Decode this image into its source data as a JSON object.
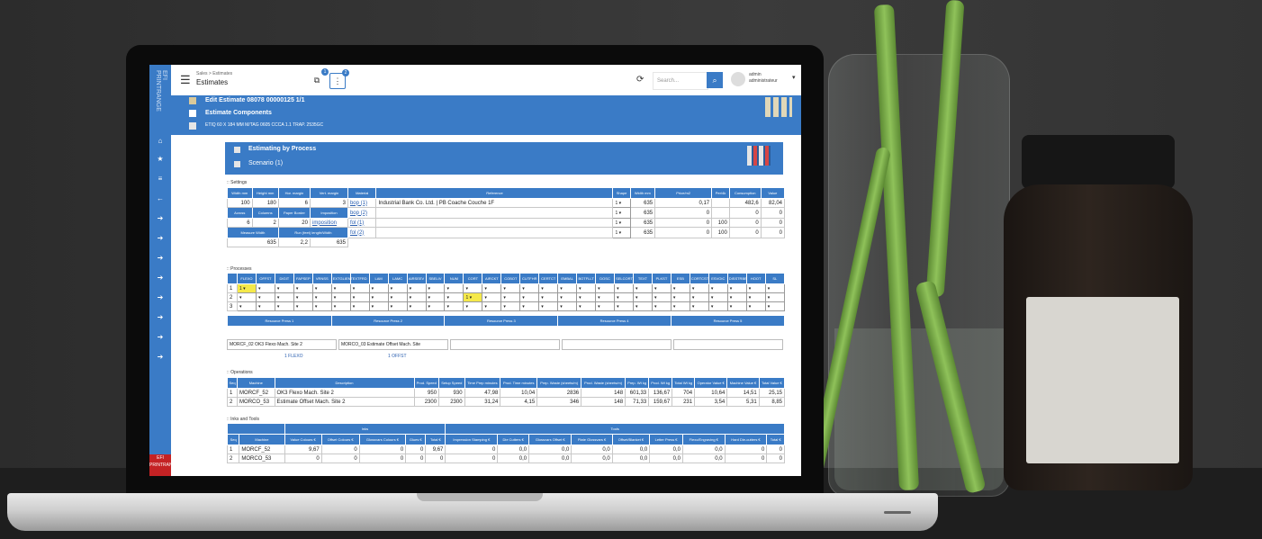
{
  "app": {
    "brand": "EFI PRINTRANGE",
    "footer": "EFI PRINTRANGE",
    "breadcrumb": "Sales > Estimates",
    "title": "Estimates",
    "badge1": "1",
    "badge2": "2",
    "search_placeholder": "Search...",
    "user_name": "admin",
    "user_company": "administrateur",
    "user_caret": "▾"
  },
  "header": {
    "line1": "Edit Estimate 08078 00000125 1/1",
    "line2": "Estimate Components",
    "line3": "ETIQ 60 X 184 MM M/TAG 0605 CCCA 1.1 TRAP. 2535GC"
  },
  "panel": {
    "title": "Estimating by Process",
    "subtitle": "Scenario (1)"
  },
  "settings": {
    "label": ":: Settings",
    "head": [
      "Width mm",
      "Height mm",
      "Hor. margin",
      "Vert. margin",
      "Material",
      "Reference",
      "Shape",
      "Width mm",
      "Price/m2",
      "Per/4k",
      "Consumption",
      "Value"
    ],
    "head2": [
      "Across",
      "Columns",
      "Paper Border",
      "Imposition"
    ],
    "head3": [
      "Measure Width",
      "Run (feet) length/Width"
    ],
    "row1": {
      "w": "100",
      "h": "180",
      "hm": "6",
      "vm": "3",
      "mat": "bop (1)",
      "ref": "Industrial Bank Co. Ltd. | PB Coache Couche 1F",
      "shape": "1 ▾",
      "width": "635",
      "price": "0,17",
      "per": "",
      "cons": "482,6",
      "val": "82,04"
    },
    "row2": {
      "a": "6",
      "c": "2",
      "pb": "20",
      "imp": "imposition",
      "mat": "bop (2)",
      "shape": "1 ▾",
      "width": "635",
      "price": "0",
      "per": "",
      "cons": "0",
      "val": "0"
    },
    "row3": {
      "mat": "fol (1)",
      "shape": "1 ▾",
      "width": "635",
      "price": "0",
      "per": "100",
      "cons": "0",
      "val": "0"
    },
    "row4": {
      "mw": "635",
      "rl": "2,2",
      "rw": "635",
      "mat": "fol (2)",
      "shape": "1 ▾",
      "width": "635",
      "price": "0",
      "per": "100",
      "cons": "0",
      "val": "0"
    }
  },
  "processes": {
    "label": ":: Processes",
    "cols": [
      "FLEXO",
      "OFFST",
      "DIGIT",
      "FAPSEP",
      "VRNSS",
      "EXTGLIENT",
      "EXTFRD",
      "LAM",
      "LAMC",
      "AIRSEEV",
      "SBELIV",
      "NUM",
      "CORT",
      "AIRCKT",
      "COBOT",
      "CUTFHR",
      "CERTCT",
      "EMBAL",
      "BOTFLLT",
      "DOSC",
      "SELCORT",
      "TEXT",
      "PLKST",
      "ESB",
      "CORTCST",
      "ESVOIC",
      "DISSTRBB",
      "HOOT",
      "SL"
    ],
    "rows": [
      "1",
      "2",
      "3"
    ],
    "sel_1_flexo": "1 ▾",
    "sel_2_cort": "1 ▾",
    "resource_heads": [
      "Resource Press 1",
      "Resource Press 2",
      "Resource Press 3",
      "Resource Press 4",
      "Resource Press 5"
    ],
    "resource1": "MORCF_02 OK3 Flexo Mach. Site 2",
    "resource2": "MORCO_03 Estimate Offset Mach. Site",
    "sub1": "1 FLEXO",
    "sub2": "1 OFFST"
  },
  "operations": {
    "label": ":: Operations",
    "head": [
      "Seq",
      "Machine",
      "Description",
      "Prod. Speed",
      "Setup Speed",
      "Time Prep minutes",
      "Prod. Time minutes",
      "Prep. Waste (sheets/m)",
      "Prod. Waste (sheets/m)",
      "Prep. Wt kg",
      "Prod. Wt kg",
      "Total Wt kg",
      "Operator Value €",
      "Machine Value €",
      "Total Value €"
    ],
    "rows": [
      [
        "1",
        "MORCF_52",
        "OK3 Flexo Mach. Site 2",
        "950",
        "930",
        "47,98",
        "10,04",
        "2836",
        "148",
        "601,33",
        "136,67",
        "704",
        "10,64",
        "14,51",
        "25,15"
      ],
      [
        "2",
        "MORCO_53",
        "Estimate Offset Mach. Site 2",
        "2300",
        "2300",
        "31,24",
        "4,15",
        "346",
        "148",
        "71,33",
        "159,67",
        "231",
        "3,54",
        "5,31",
        "8,85"
      ]
    ]
  },
  "inks": {
    "label": ":: Inks and Tools",
    "group1": "Inks",
    "group2": "Tools",
    "head": [
      "Seq",
      "Machine",
      "Value Colours €",
      "Offset Colours €",
      "Glossvars Colours €",
      "Glues €",
      "Total €",
      "Impression Stamping €",
      "Die Cutters €",
      "Glossvars Offset €",
      "Plate Glossvars €",
      "Offset/Blanket €",
      "Letter Press €",
      "Flexo/Engraving €",
      "Hard Die-cutters €",
      "Total €"
    ],
    "rows": [
      [
        "1",
        "MORCF_52",
        "9,67",
        "0",
        "0",
        "0",
        "9,67",
        "0",
        "0,0",
        "0,0",
        "0,0",
        "0,0",
        "0,0",
        "0,0",
        "0",
        "0"
      ],
      [
        "2",
        "MORCO_53",
        "0",
        "0",
        "0",
        "0",
        "0",
        "0",
        "0,0",
        "0,0",
        "0,0",
        "0,0",
        "0,0",
        "0,0",
        "0",
        "0"
      ]
    ]
  }
}
